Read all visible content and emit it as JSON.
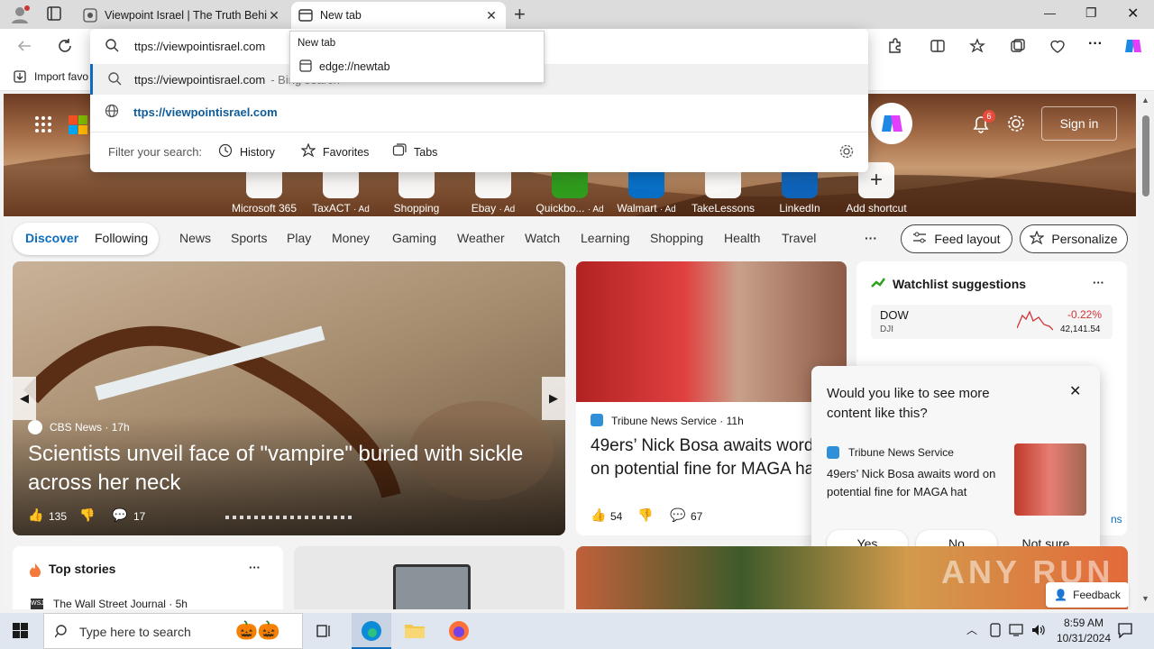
{
  "browser": {
    "tabs": [
      {
        "title": "Viewpoint Israel | The Truth Behin",
        "close": "✕"
      },
      {
        "title": "New tab",
        "close": "✕"
      }
    ],
    "new_tab_symbol": "+",
    "window_controls": {
      "minimize": "—",
      "maximize": "❐",
      "close": "✕"
    },
    "address_text": "ttps://viewpointisrael.com",
    "favorites_import": "Import favo",
    "hover_popup": {
      "title": "New tab",
      "url": "edge://newtab"
    }
  },
  "omnibox": {
    "row1": {
      "text": "ttps://viewpointisrael.com",
      "suffix": "- Bing search"
    },
    "row2": {
      "text": "ttps://viewpointisrael.com"
    },
    "filter_label": "Filter your search:",
    "filters": [
      "History",
      "Favorites",
      "Tabs"
    ]
  },
  "newtab": {
    "sign_in": "Sign in",
    "notification_count": "6",
    "shortcuts": [
      {
        "label": "Microsoft 365",
        "ad": ""
      },
      {
        "label": "TaxACT",
        "ad": "· Ad"
      },
      {
        "label": "Shopping",
        "ad": ""
      },
      {
        "label": "Ebay",
        "ad": "· Ad"
      },
      {
        "label": "Quickbo...",
        "ad": "· Ad"
      },
      {
        "label": "Walmart",
        "ad": "· Ad"
      },
      {
        "label": "TakeLessons",
        "ad": ""
      },
      {
        "label": "LinkedIn",
        "ad": ""
      },
      {
        "label": "Add shortcut",
        "ad": ""
      }
    ],
    "nav": {
      "discover": "Discover",
      "following": "Following",
      "links": [
        "News",
        "Sports",
        "Play",
        "Money",
        "Gaming",
        "Weather",
        "Watch",
        "Learning",
        "Shopping",
        "Health",
        "Travel"
      ],
      "more": "···",
      "feed_layout": "Feed layout",
      "personalize": "Personalize"
    },
    "main_story": {
      "source": "CBS News",
      "age": "· 17h",
      "title": "Scientists unveil face of \"vampire\" buried with sickle across her neck",
      "likes": "135",
      "comments": "17"
    },
    "second_story": {
      "source": "Tribune News Service",
      "age": "· 11h",
      "title": "49ers’ Nick Bosa awaits word on potential fine for MAGA hat",
      "likes": "54",
      "comments": "67"
    },
    "watchlist": {
      "title": "Watchlist suggestions",
      "more": "···",
      "stock": {
        "symbol": "DOW",
        "sub": "DJI",
        "change": "-0.22%",
        "price": "42,141.54"
      },
      "partial_link": "ns"
    },
    "feedback_popup": {
      "question": "Would you like to see more content like this?",
      "source": "Tribune News Service",
      "headline": "49ers’ Nick Bosa awaits word on potential fine for MAGA hat",
      "yes": "Yes",
      "no": "No",
      "not_sure": "Not sure"
    },
    "top_stories": {
      "title": "Top stories",
      "more": "···",
      "first_source": "The Wall Street Journal",
      "first_age": "· 5h"
    },
    "feedback_button": "Feedback",
    "watermark": "ANY RUN"
  },
  "taskbar": {
    "search_placeholder": "Type here to search",
    "time": "8:59 AM",
    "date": "10/31/2024"
  },
  "colors": {
    "accent": "#0f6cbd",
    "negative": "#d13438"
  }
}
